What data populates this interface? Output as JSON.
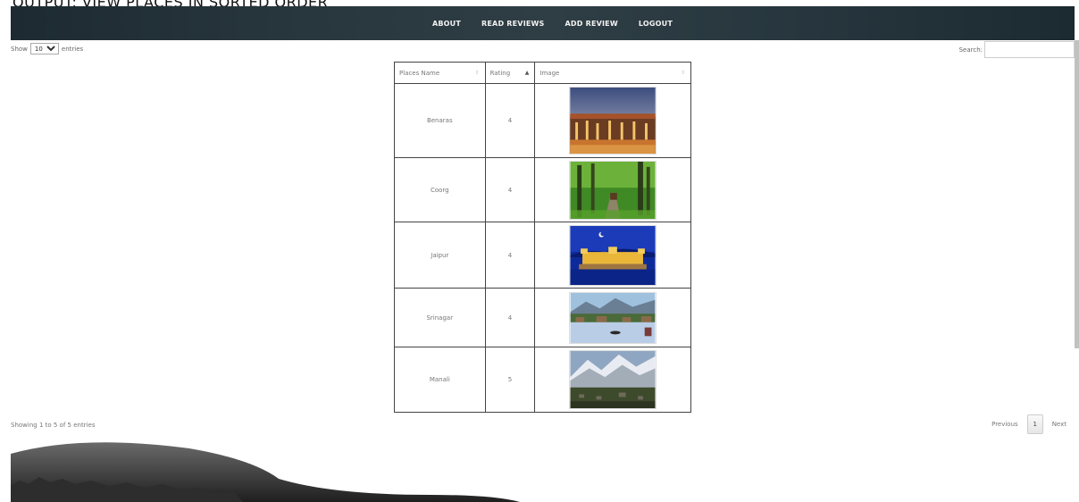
{
  "caption": "OUTPUT: VIEW PLACES IN SORTED ORDER",
  "nav": {
    "items": [
      "ABOUT",
      "READ REVIEWS",
      "ADD REVIEW",
      "LOGOUT"
    ]
  },
  "controls": {
    "show_label": "Show",
    "entries_value": "10",
    "entries_label": "entries",
    "search_label": "Search:",
    "search_value": ""
  },
  "table": {
    "headers": [
      "Places Name",
      "Rating",
      "Image"
    ],
    "rows": [
      {
        "name": "Benaras",
        "rating": "4",
        "image": "benaras-ghat-photo"
      },
      {
        "name": "Coorg",
        "rating": "4",
        "image": "coorg-forest-road-photo"
      },
      {
        "name": "Jaipur",
        "rating": "4",
        "image": "jaipur-jal-mahal-photo"
      },
      {
        "name": "Srinagar",
        "rating": "4",
        "image": "srinagar-dal-lake-photo"
      },
      {
        "name": "Manali",
        "rating": "5",
        "image": "manali-mountains-photo"
      }
    ]
  },
  "footer": {
    "info": "Showing 1 to 5 of 5 entries",
    "previous": "Previous",
    "page": "1",
    "next": "Next"
  },
  "colors": {
    "navbar": "#27353d",
    "table_border": "#444444"
  }
}
